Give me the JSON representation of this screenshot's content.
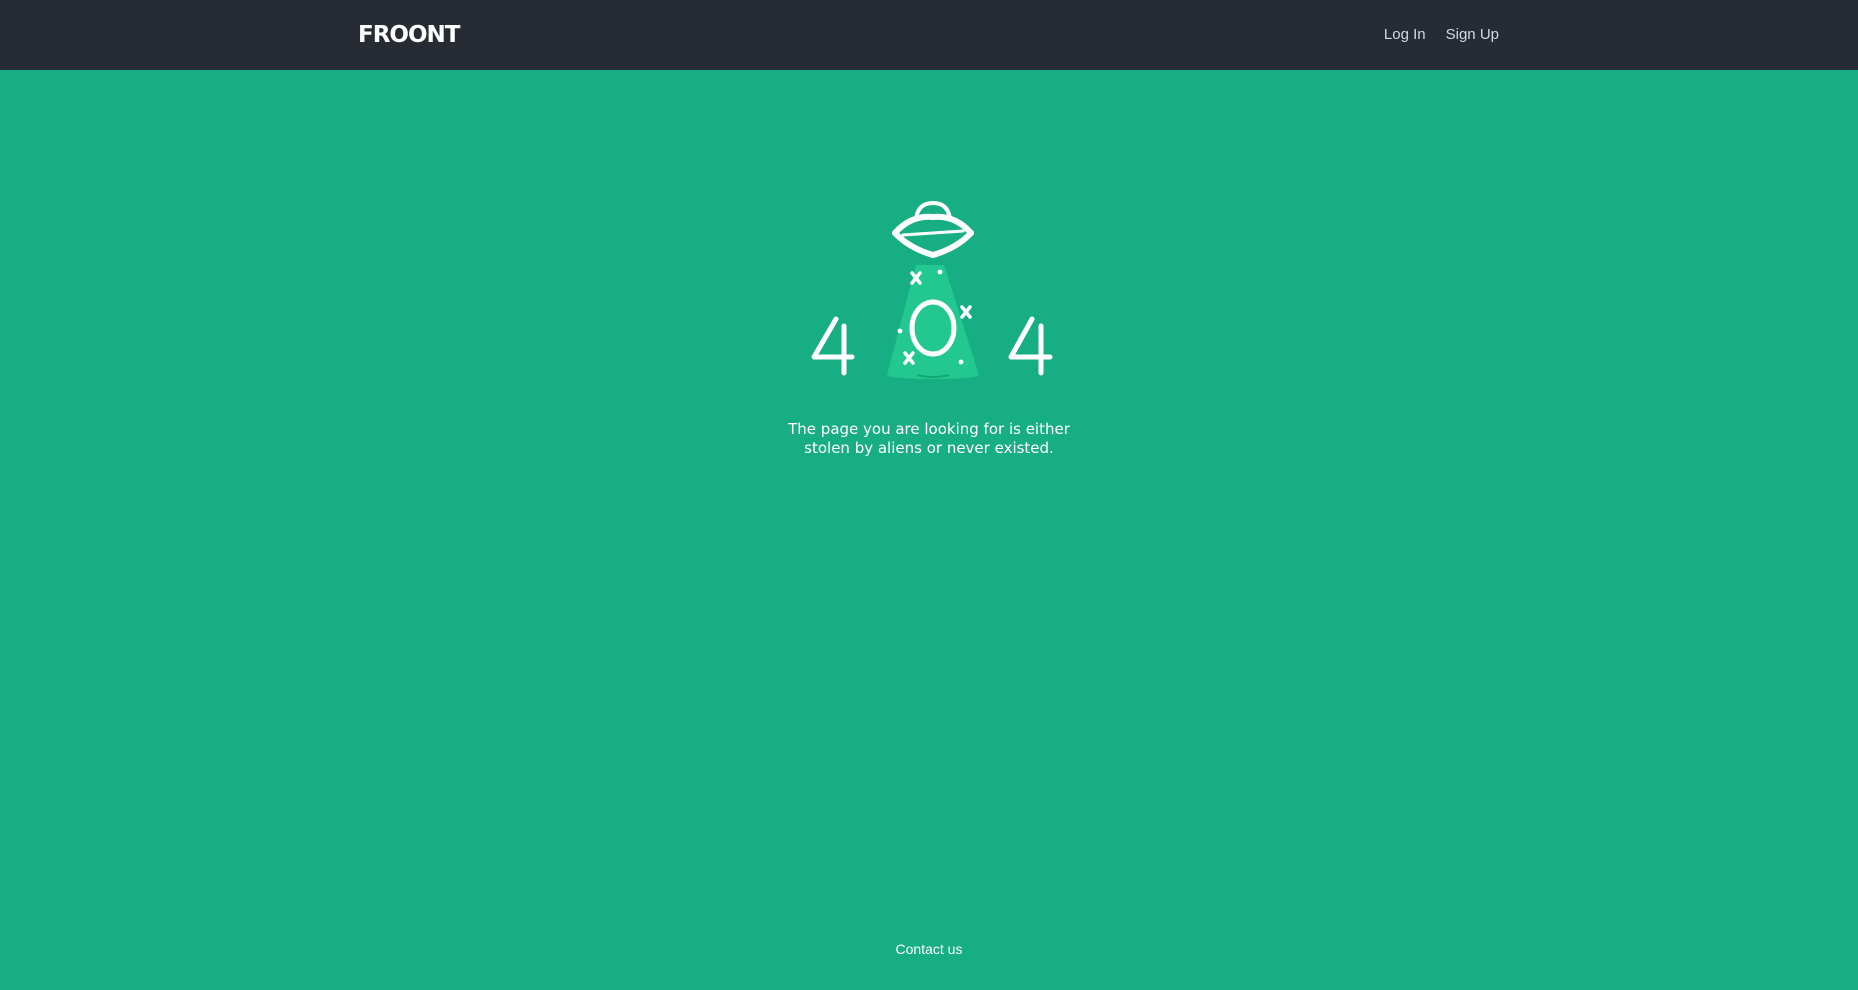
{
  "header": {
    "logo": "FROONT",
    "nav": {
      "login": "Log In",
      "signup": "Sign Up"
    }
  },
  "error": {
    "code_digits": [
      "4",
      "O",
      "4"
    ],
    "message_line1": "The page you are looking for is either",
    "message_line2": "stolen by aliens or never existed."
  },
  "footer": {
    "contact": "Contact us"
  },
  "colors": {
    "background": "#18ae84",
    "topbar": "#262b34",
    "beam": "#22c88f",
    "text": "#ffffff"
  },
  "icons": [
    "ufo-icon",
    "tractor-beam",
    "sparkle-icon"
  ]
}
